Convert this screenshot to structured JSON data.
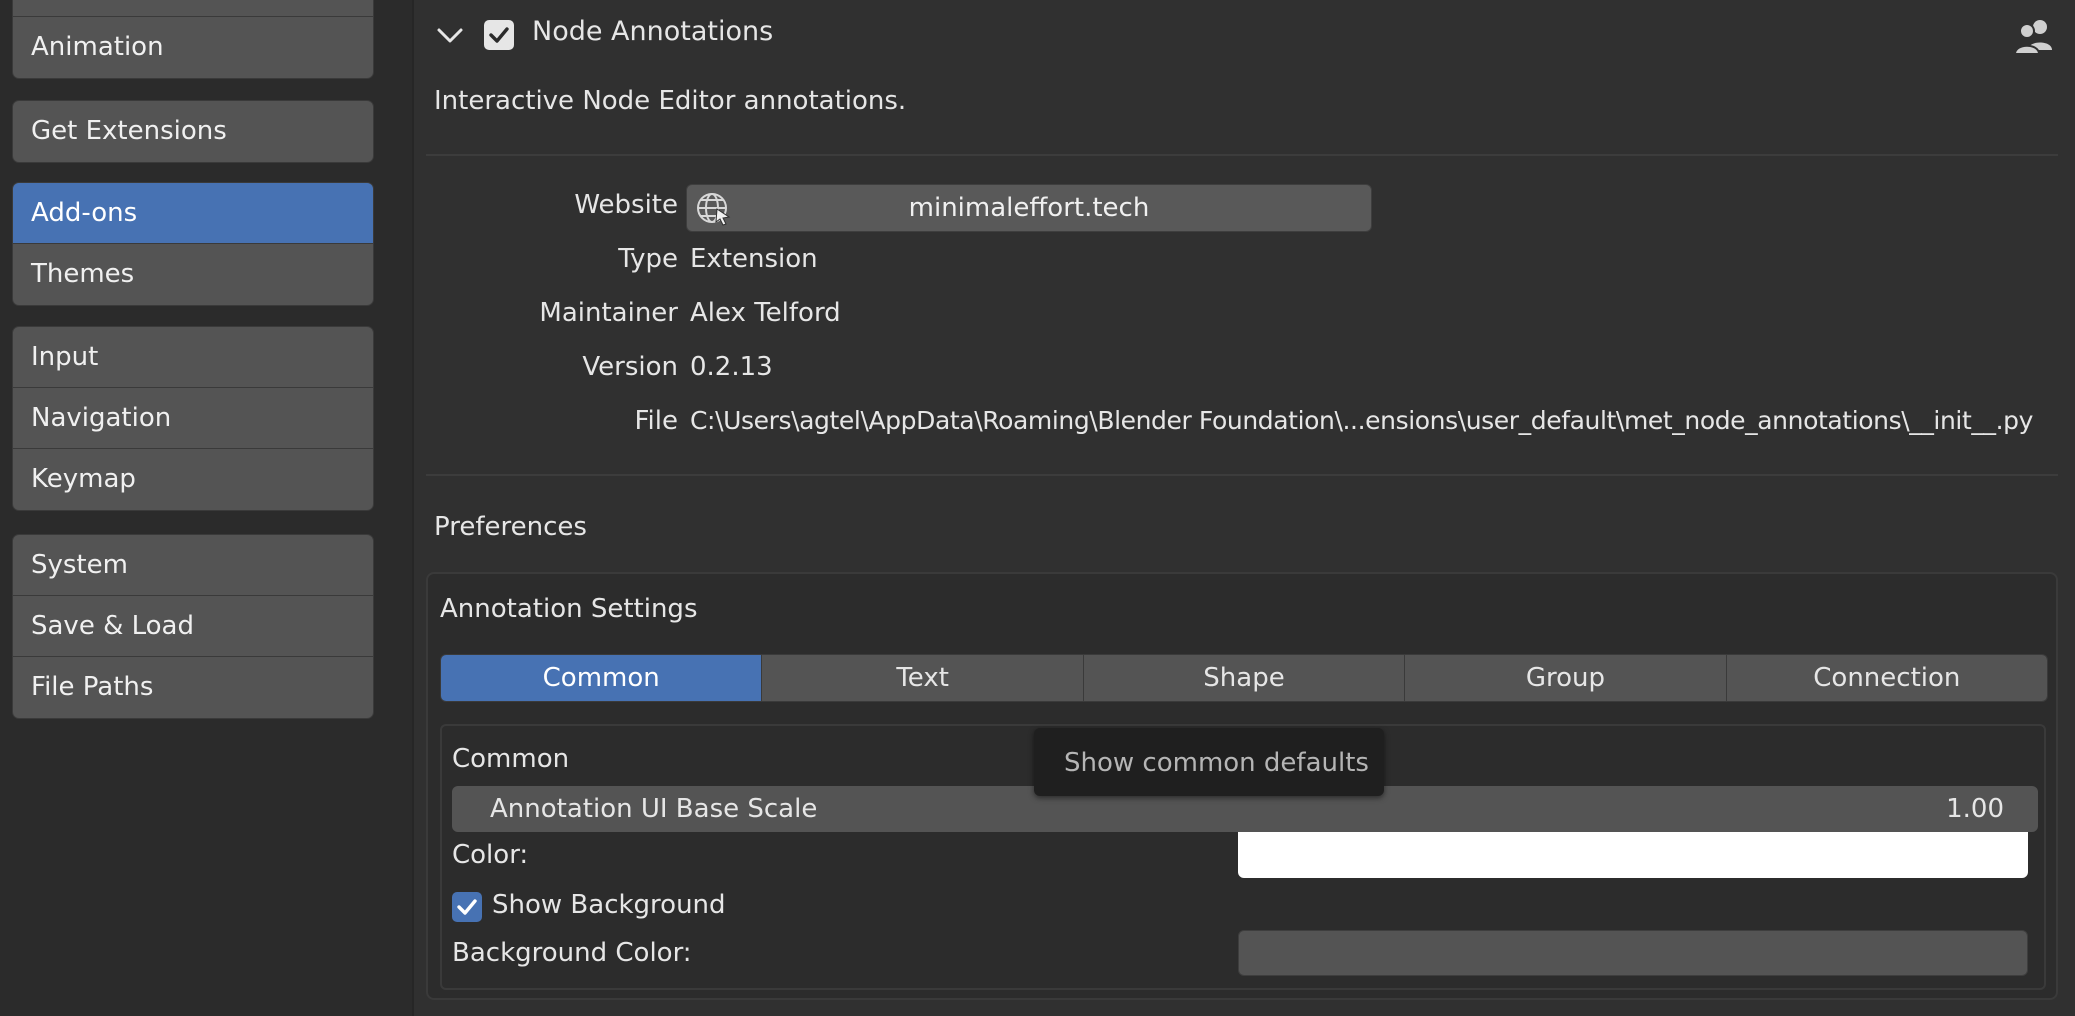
{
  "sidebar": {
    "groups": [
      {
        "items": [
          "Animation"
        ]
      },
      {
        "items": [
          "Get Extensions"
        ]
      },
      {
        "items": [
          "Add-ons",
          "Themes"
        ]
      },
      {
        "items": [
          "Input",
          "Navigation",
          "Keymap"
        ]
      },
      {
        "items": [
          "System",
          "Save & Load",
          "File Paths"
        ]
      }
    ],
    "active_item": "Add-ons"
  },
  "addon": {
    "title": "Node Annotations",
    "enabled": true,
    "description": "Interactive Node Editor annotations.",
    "details": {
      "website_label": "Website",
      "website_value": "minimaleffort.tech",
      "type_label": "Type",
      "type_value": "Extension",
      "maintainer_label": "Maintainer",
      "maintainer_value": "Alex Telford",
      "version_label": "Version",
      "version_value": "0.2.13",
      "file_label": "File",
      "file_value": "C:\\Users\\agtel\\AppData\\Roaming\\Blender Foundation\\...ensions\\user_default\\met_node_annotations\\__init__.py"
    },
    "preferences_heading": "Preferences",
    "settings": {
      "heading": "Annotation Settings",
      "tabs": [
        "Common",
        "Text",
        "Shape",
        "Group",
        "Connection"
      ],
      "active_tab": "Common",
      "common": {
        "heading": "Common",
        "scale_label": "Annotation UI Base Scale",
        "scale_value": "1.00",
        "color_label": "Color:",
        "color_value": "#ffffff",
        "show_background_label": "Show Background",
        "show_background_checked": true,
        "background_color_label": "Background Color:",
        "background_color_value": "#545454"
      }
    },
    "tooltip": "Show common defaults"
  },
  "colors": {
    "accent": "#4772b3",
    "panel": "#303030",
    "widget": "#545454"
  }
}
